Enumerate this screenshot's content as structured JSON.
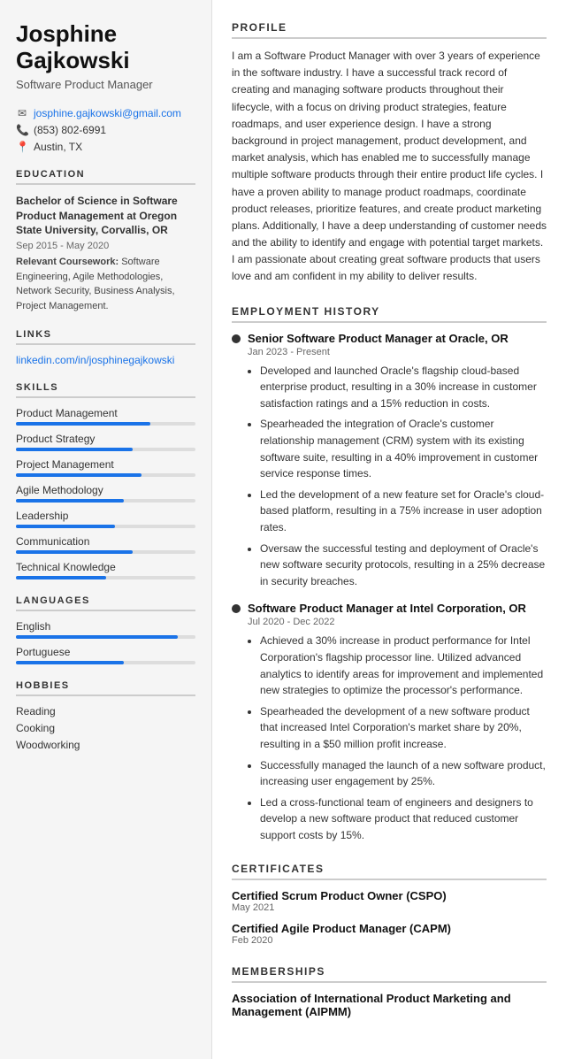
{
  "sidebar": {
    "name": "Josphine Gajkowski",
    "name_line1": "Josphine",
    "name_line2": "Gajkowski",
    "job_title": "Software Product Manager",
    "contact": {
      "email": "josphine.gajkowski@gmail.com",
      "phone": "(853) 802-6991",
      "location": "Austin, TX"
    },
    "education_section": "EDUCATION",
    "education": {
      "degree": "Bachelor of Science in Software Product Management at Oregon State University, Corvallis, OR",
      "dates": "Sep 2015 - May 2020",
      "courses_label": "Relevant Coursework:",
      "courses": "Software Engineering, Agile Methodologies, Network Security, Business Analysis, Project Management."
    },
    "links_section": "LINKS",
    "links": [
      {
        "text": "linkedin.com/in/josphinegajkowski",
        "url": "#"
      }
    ],
    "skills_section": "SKILLS",
    "skills": [
      {
        "label": "Product Management",
        "pct": 75
      },
      {
        "label": "Product Strategy",
        "pct": 65
      },
      {
        "label": "Project Management",
        "pct": 70
      },
      {
        "label": "Agile Methodology",
        "pct": 60
      },
      {
        "label": "Leadership",
        "pct": 55
      },
      {
        "label": "Communication",
        "pct": 65
      },
      {
        "label": "Technical Knowledge",
        "pct": 50
      }
    ],
    "languages_section": "LANGUAGES",
    "languages": [
      {
        "label": "English",
        "pct": 90
      },
      {
        "label": "Portuguese",
        "pct": 60
      }
    ],
    "hobbies_section": "HOBBIES",
    "hobbies": [
      "Reading",
      "Cooking",
      "Woodworking"
    ]
  },
  "main": {
    "profile_section": "PROFILE",
    "profile_text": "I am a Software Product Manager with over 3 years of experience in the software industry. I have a successful track record of creating and managing software products throughout their lifecycle, with a focus on driving product strategies, feature roadmaps, and user experience design. I have a strong background in project management, product development, and market analysis, which has enabled me to successfully manage multiple software products through their entire product life cycles. I have a proven ability to manage product roadmaps, coordinate product releases, prioritize features, and create product marketing plans. Additionally, I have a deep understanding of customer needs and the ability to identify and engage with potential target markets. I am passionate about creating great software products that users love and am confident in my ability to deliver results.",
    "employment_section": "EMPLOYMENT HISTORY",
    "employment": [
      {
        "title": "Senior Software Product Manager at Oracle, OR",
        "dates": "Jan 2023 - Present",
        "bullets": [
          "Developed and launched Oracle's flagship cloud-based enterprise product, resulting in a 30% increase in customer satisfaction ratings and a 15% reduction in costs.",
          "Spearheaded the integration of Oracle's customer relationship management (CRM) system with its existing software suite, resulting in a 40% improvement in customer service response times.",
          "Led the development of a new feature set for Oracle's cloud-based platform, resulting in a 75% increase in user adoption rates.",
          "Oversaw the successful testing and deployment of Oracle's new software security protocols, resulting in a 25% decrease in security breaches."
        ]
      },
      {
        "title": "Software Product Manager at Intel Corporation, OR",
        "dates": "Jul 2020 - Dec 2022",
        "bullets": [
          "Achieved a 30% increase in product performance for Intel Corporation's flagship processor line. Utilized advanced analytics to identify areas for improvement and implemented new strategies to optimize the processor's performance.",
          "Spearheaded the development of a new software product that increased Intel Corporation's market share by 20%, resulting in a $50 million profit increase.",
          "Successfully managed the launch of a new software product, increasing user engagement by 25%.",
          "Led a cross-functional team of engineers and designers to develop a new software product that reduced customer support costs by 15%."
        ]
      }
    ],
    "certificates_section": "CERTIFICATES",
    "certificates": [
      {
        "name": "Certified Scrum Product Owner (CSPO)",
        "date": "May 2021"
      },
      {
        "name": "Certified Agile Product Manager (CAPM)",
        "date": "Feb 2020"
      }
    ],
    "memberships_section": "MEMBERSHIPS",
    "memberships": [
      {
        "name": "Association of International Product Marketing and Management (AIPMM)"
      }
    ]
  }
}
